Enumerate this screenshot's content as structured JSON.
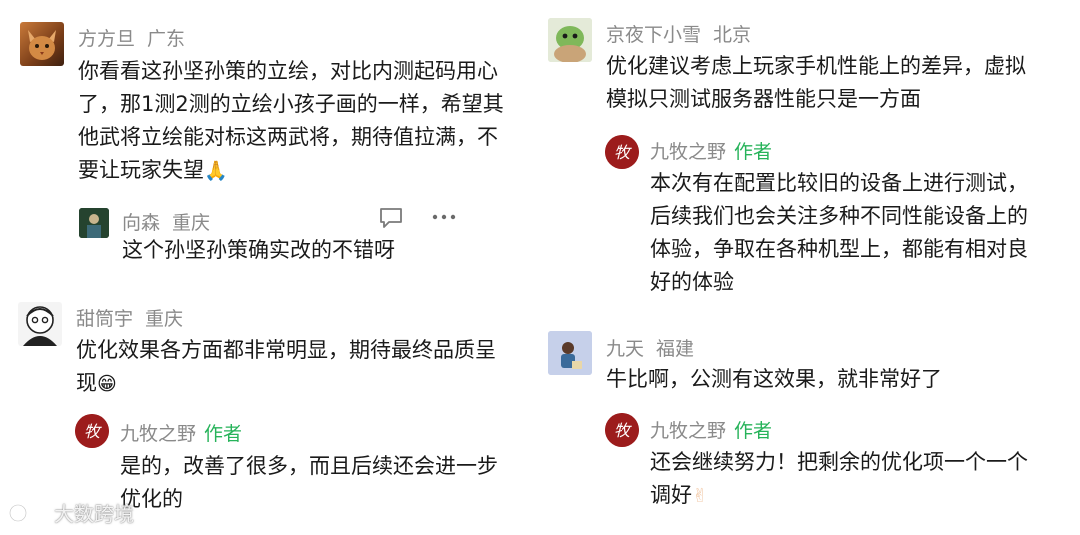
{
  "comments": [
    {
      "user": "方方旦",
      "region": "广东",
      "text": "你看看这孙坚孙策的立绘，对比内测起码用心了，那1测2测的立绘小孩子画的一样，希望其他武将立绘能对标这两武将，期待值拉满，不要让玩家失望",
      "emoji": "🙏",
      "reply": {
        "user": "向森",
        "region": "重庆",
        "text": "这个孙坚孙策确实改的不错呀"
      }
    },
    {
      "user": "甜筒宇",
      "region": "重庆",
      "text": "优化效果各方面都非常明显，期待最终品质呈现",
      "emoji": "😁",
      "reply": {
        "user": "九牧之野",
        "badge": "作者",
        "text": "是的，改善了很多，而且后续还会进一步优化的"
      }
    },
    {
      "user": "京夜下小雪",
      "region": "北京",
      "text": "优化建议考虑上玩家手机性能上的差异，虚拟模拟只测试服务器性能只是一方面",
      "reply": {
        "user": "九牧之野",
        "badge": "作者",
        "text": "本次有在配置比较旧的设备上进行测试，后续我们也会关注多种不同性能设备上的体验，争取在各种机型上，都能有相对良好的体验"
      }
    },
    {
      "user": "九天",
      "region": "福建",
      "text": "牛比啊，公测有这效果，就非常好了",
      "reply": {
        "user": "九牧之野",
        "badge": "作者",
        "text": "还会继续努力！把剩余的优化项一个一个调好",
        "emoji": "✌"
      }
    }
  ],
  "avatar_glyph": "牧",
  "watermark": "大数跨境",
  "icons": [
    "comment-icon",
    "more-icon",
    "author-logo-icon",
    "watermark-logo-icon"
  ]
}
